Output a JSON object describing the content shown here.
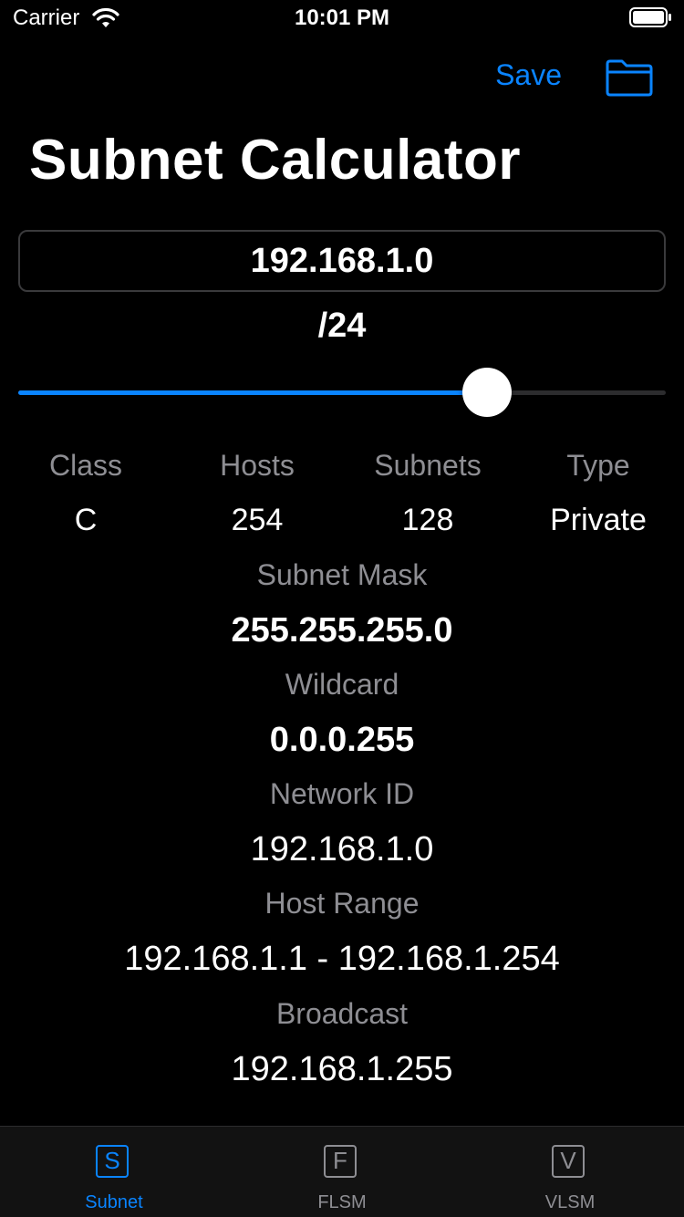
{
  "status_bar": {
    "carrier": "Carrier",
    "time": "10:01 PM",
    "wifi_icon": "wifi-icon",
    "battery_icon": "battery-icon"
  },
  "nav": {
    "save_label": "Save",
    "folder_icon": "folder-icon"
  },
  "title": "Subnet Calculator",
  "ip_input": {
    "value": "192.168.1.0",
    "placeholder": ""
  },
  "cidr": {
    "label": "/24",
    "prefix": 24,
    "slider_min": 1,
    "slider_max": 32
  },
  "stats": [
    {
      "label": "Class",
      "value": "C"
    },
    {
      "label": "Hosts",
      "value": "254"
    },
    {
      "label": "Subnets",
      "value": "128"
    },
    {
      "label": "Type",
      "value": "Private"
    }
  ],
  "details": {
    "subnet_mask": {
      "label": "Subnet Mask",
      "value": "255.255.255.0"
    },
    "wildcard": {
      "label": "Wildcard",
      "value": "0.0.0.255"
    },
    "network_id": {
      "label": "Network ID",
      "value": "192.168.1.0"
    },
    "host_range": {
      "label": "Host Range",
      "value": "192.168.1.1 - 192.168.1.254"
    },
    "broadcast": {
      "label": "Broadcast",
      "value": "192.168.1.255"
    }
  },
  "tabs": [
    {
      "label": "Subnet",
      "icon_letter": "S",
      "active": true
    },
    {
      "label": "FLSM",
      "icon_letter": "F",
      "active": false
    },
    {
      "label": "VLSM",
      "icon_letter": "V",
      "active": false
    }
  ],
  "colors": {
    "accent": "#0a84ff",
    "background": "#000000",
    "secondary_text": "#8e8e93"
  }
}
